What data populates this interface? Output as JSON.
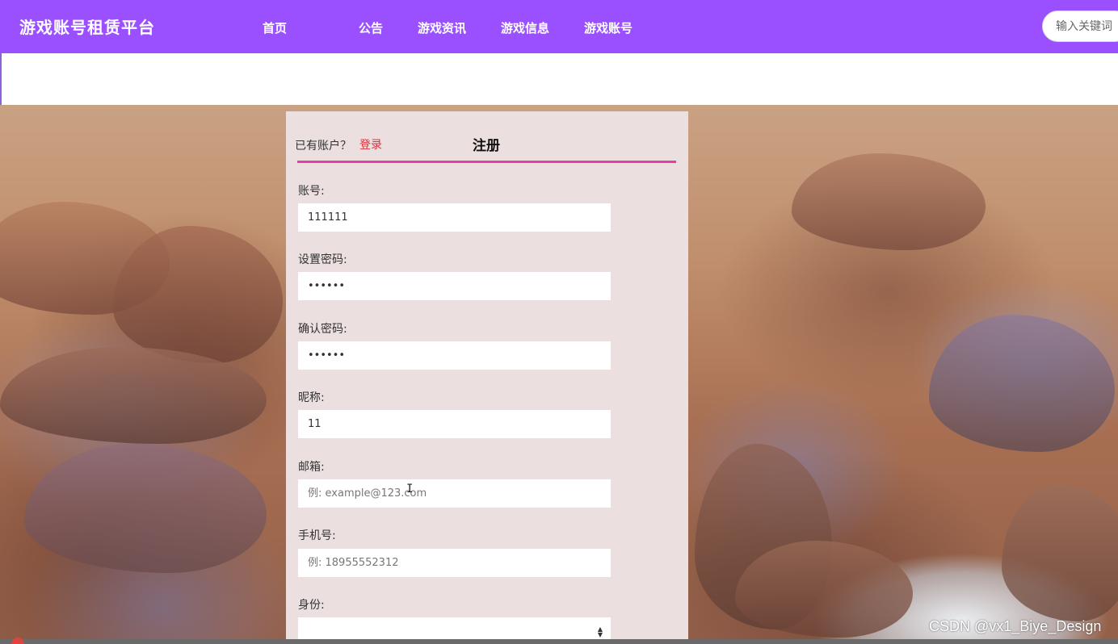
{
  "header": {
    "brand": "游戏账号租赁平台",
    "nav": [
      {
        "label": "首页"
      },
      {
        "label": "公告"
      },
      {
        "label": "游戏资讯"
      },
      {
        "label": "游戏信息"
      },
      {
        "label": "游戏账号"
      }
    ],
    "search": {
      "placeholder": "输入关键词"
    },
    "accent_color": "#9a50ff"
  },
  "form": {
    "have_account": "已有账户？",
    "login_link": "登录",
    "register_title": "注册",
    "underline_color": "#e23fa6",
    "fields": [
      {
        "label": "账号:",
        "value": "111111",
        "placeholder": ""
      },
      {
        "label": "设置密码:",
        "value": "••••••",
        "placeholder": ""
      },
      {
        "label": "确认密码:",
        "value": "••••••",
        "placeholder": ""
      },
      {
        "label": "昵称:",
        "value": "11",
        "placeholder": ""
      },
      {
        "label": "邮箱:",
        "value": "",
        "placeholder": "例: example@123.com"
      },
      {
        "label": "手机号:",
        "value": "",
        "placeholder": "例: 18955552312"
      }
    ],
    "identity": {
      "label": "身份:",
      "value": ""
    }
  },
  "watermark": "CSDN @vx1_Biye_Design"
}
